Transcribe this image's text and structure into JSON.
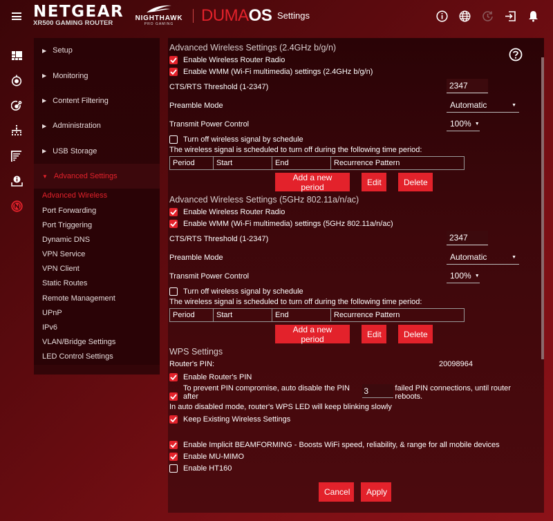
{
  "header": {
    "brand": "NETGEAR",
    "model": "XR500 GAMING ROUTER",
    "nighthawk": "NIGHTHAWK",
    "nighthawk_sub": "PRO GAMING",
    "duma_part1": "DUMA",
    "duma_part2": "OS",
    "page_title": "Settings",
    "icons": [
      "info-icon",
      "globe-icon",
      "refresh-icon",
      "logout-icon",
      "bell-icon"
    ]
  },
  "rail_icons": [
    "dashboard-icon",
    "monitoring-icon",
    "content-filter-icon",
    "network-icon",
    "usb-storage-icon",
    "admin-icon",
    "netgear-icon"
  ],
  "sidebar": {
    "items": [
      {
        "label": "Setup",
        "expanded": false
      },
      {
        "label": "Monitoring",
        "expanded": false
      },
      {
        "label": "Content Filtering",
        "expanded": false
      },
      {
        "label": "Administration",
        "expanded": false
      },
      {
        "label": "USB Storage",
        "expanded": false
      },
      {
        "label": "Advanced Settings",
        "expanded": true
      }
    ],
    "subitems": [
      {
        "label": "Advanced Wireless",
        "active": true
      },
      {
        "label": "Port Forwarding"
      },
      {
        "label": "Port Triggering"
      },
      {
        "label": "Dynamic DNS"
      },
      {
        "label": "VPN Service"
      },
      {
        "label": "VPN Client"
      },
      {
        "label": "Static Routes"
      },
      {
        "label": "Remote Management"
      },
      {
        "label": "UPnP"
      },
      {
        "label": "IPv6"
      },
      {
        "label": "VLAN/Bridge Settings"
      },
      {
        "label": "LED Control Settings"
      }
    ]
  },
  "band24": {
    "title": "Advanced Wireless Settings (2.4GHz b/g/n)",
    "enable_radio": {
      "label": "Enable Wireless Router Radio",
      "checked": true
    },
    "enable_wmm": {
      "label": "Enable WMM (Wi-Fi multimedia) settings (2.4GHz b/g/n)",
      "checked": true
    },
    "cts_label": "CTS/RTS Threshold (1-2347)",
    "cts_value": "2347",
    "preamble_label": "Preamble Mode",
    "preamble_value": "Automatic",
    "power_label": "Transmit Power Control",
    "power_value": "100%",
    "schedule": {
      "label": "Turn off wireless signal by schedule",
      "checked": false
    },
    "schedule_note": "The wireless signal is scheduled to turn off during the following time period:",
    "table_headers": [
      "Period",
      "Start",
      "End",
      "Recurrence Pattern"
    ],
    "add_btn": "Add a new period",
    "edit_btn": "Edit",
    "delete_btn": "Delete"
  },
  "band5": {
    "title": "Advanced Wireless Settings (5GHz 802.11a/n/ac)",
    "enable_radio": {
      "label": "Enable Wireless Router Radio",
      "checked": true
    },
    "enable_wmm": {
      "label": "Enable WMM (Wi-Fi multimedia) settings (5GHz 802.11a/n/ac)",
      "checked": true
    },
    "cts_label": "CTS/RTS Threshold (1-2347)",
    "cts_value": "2347",
    "preamble_label": "Preamble Mode",
    "preamble_value": "Automatic",
    "power_label": "Transmit Power Control",
    "power_value": "100%",
    "schedule": {
      "label": "Turn off wireless signal by schedule",
      "checked": false
    },
    "schedule_note": "The wireless signal is scheduled to turn off during the following time period:",
    "table_headers": [
      "Period",
      "Start",
      "End",
      "Recurrence Pattern"
    ],
    "add_btn": "Add a new period",
    "edit_btn": "Edit",
    "delete_btn": "Delete"
  },
  "wps": {
    "title": "WPS Settings",
    "pin_label": "Router's PIN:",
    "pin_value": "20098964",
    "enable_pin": {
      "label": "Enable Router's PIN",
      "checked": true
    },
    "auto_disable": {
      "label_before": "To prevent PIN compromise, auto disable the PIN after",
      "value": "3",
      "label_after": "failed PIN connections, until router reboots.",
      "checked": true
    },
    "auto_disable_note": "In auto disabled mode, router's WPS LED will keep blinking slowly",
    "keep_existing": {
      "label": "Keep Existing Wireless Settings",
      "checked": true
    }
  },
  "extras": {
    "beamforming": {
      "label": "Enable Implicit BEAMFORMING - Boosts WiFi speed, reliability, & range for all mobile devices",
      "checked": true
    },
    "mumimo": {
      "label": "Enable MU-MIMO",
      "checked": true
    },
    "ht160": {
      "label": "Enable HT160",
      "checked": false
    }
  },
  "actions": {
    "cancel": "Cancel",
    "apply": "Apply"
  },
  "colors": {
    "accent": "#e3222b"
  }
}
